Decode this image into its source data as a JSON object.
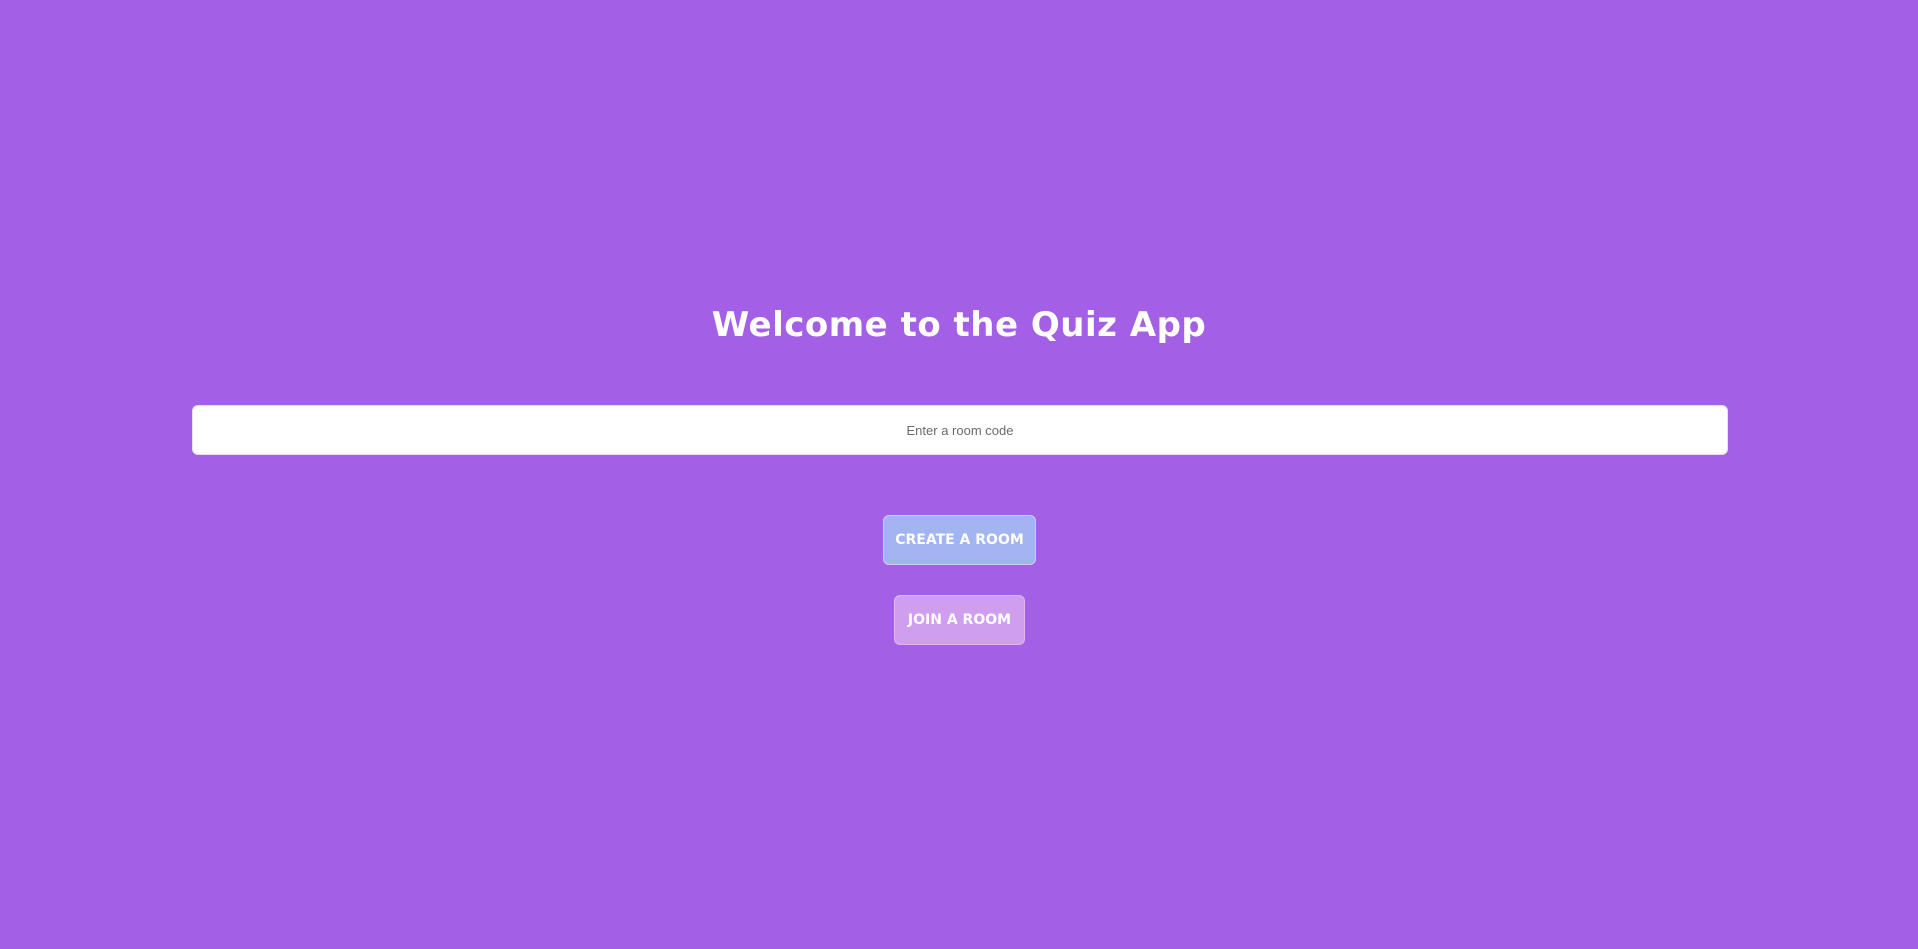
{
  "page": {
    "title": "Welcome to the Quiz App",
    "background_color": "#a360e6"
  },
  "room_code_input": {
    "placeholder": "Enter a room code",
    "value": ""
  },
  "buttons": {
    "create_label": "CREATE A ROOM",
    "create_color": "#a3b4f3",
    "join_label": "JOIN A ROOM",
    "join_color": "#cf9eef"
  }
}
